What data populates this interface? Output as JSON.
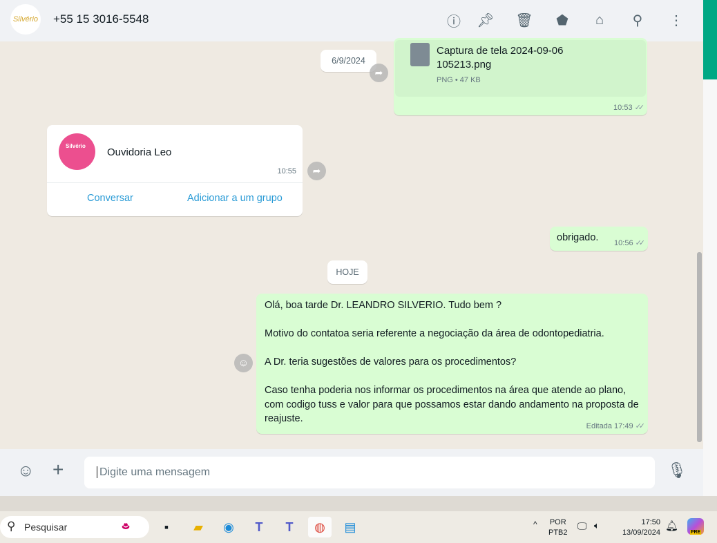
{
  "header": {
    "contact": "+55 15 3016-5548",
    "avatar_text": "Silvério",
    "icons": [
      "info-icon",
      "pin-icon",
      "delete-icon",
      "label-icon",
      "store-icon",
      "search-icon",
      "menu-icon"
    ]
  },
  "messages": {
    "file": {
      "name_line1": "Captura de tela 2024-09-06",
      "name_line2": "105213.png",
      "info": "PNG • 47 KB",
      "time": "10:53"
    },
    "date1": "6/9/2024",
    "contact_card": {
      "name": "Ouvidoria Leo",
      "avatar_text": "Silvério",
      "time": "10:55",
      "action1": "Conversar",
      "action2": "Adicionar a um grupo"
    },
    "thanks": {
      "text": "obrigado.",
      "time": "10:56"
    },
    "date2": "HOJE",
    "long": {
      "p1": "Olá, boa tarde Dr. LEANDRO SILVERIO. Tudo bem ?",
      "p2": "Motivo do contatoa seria referente a negociação da área de odontopediatria.",
      "p3": "A Dr. teria sugestões de valores para os procedimentos?",
      "p4": "Caso tenha poderia nos informar os procedimentos na área que atende ao plano, com codigo tuss e valor para que possamos estar dando andamento na proposta de reajuste.",
      "edited": "Editada",
      "time": "17:49"
    }
  },
  "composer": {
    "placeholder": "Digite uma mensagem"
  },
  "taskbar": {
    "search": "Pesquisar",
    "lang1": "POR",
    "lang2": "PTB2",
    "time": "17:50",
    "date": "13/09/2024",
    "copilot_badge": "PRE"
  },
  "colors": {
    "accent": "#00a884",
    "outgoing": "#d9fdd3",
    "link": "#027eb5"
  }
}
